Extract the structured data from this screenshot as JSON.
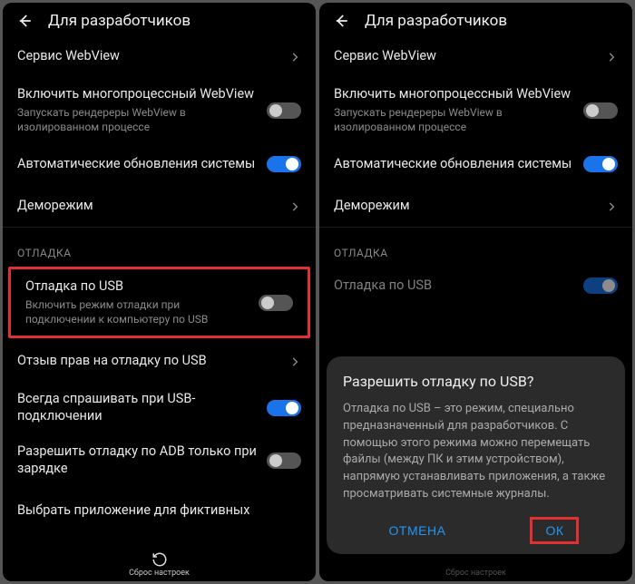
{
  "header": {
    "title": "Для разработчиков"
  },
  "left": {
    "rows": {
      "webview_service": "Сервис WebView",
      "multiprocess_title": "Включить многопроцессный WebView",
      "multiprocess_sub": "Запускать рендереры WebView в изолированном процессе",
      "auto_update": "Автоматические обновления системы",
      "demo_mode": "Деморежим",
      "section_debug": "ОТЛАДКА",
      "usb_debug_title": "Отладка по USB",
      "usb_debug_sub": "Включить режим отладки при подключении к компьютеру по USB",
      "revoke_usb": "Отзыв прав на отладку по USB",
      "always_ask_usb": "Всегда спрашивать при USB-подключении",
      "adb_charge_only": "Разрешить отладку по ADB только при зарядке",
      "select_mock_app": "Выбрать приложение для фиктивных"
    }
  },
  "right": {
    "rows": {
      "webview_service": "Сервис WebView",
      "multiprocess_title": "Включить многопроцессный WebView",
      "multiprocess_sub": "Запускать рендереры WebView в изолированном процессе",
      "auto_update": "Автоматические обновления системы",
      "demo_mode": "Деморежим",
      "section_debug": "ОТЛАДКА",
      "usb_debug_title": "Отладка по USB"
    },
    "dialog": {
      "title": "Разрешить отладку по USB?",
      "body": "Отладка по USB – это режим, специально предназначенный для разработчиков. С помощью этого режима можно перемещать файлы (между ПК и этим устройством), напрямую устанавливать приложения, а также просматривать системные журналы.",
      "cancel": "ОТМЕНА",
      "ok": "ОК"
    }
  },
  "bottom": {
    "reset_label": "Сброс настроек"
  }
}
